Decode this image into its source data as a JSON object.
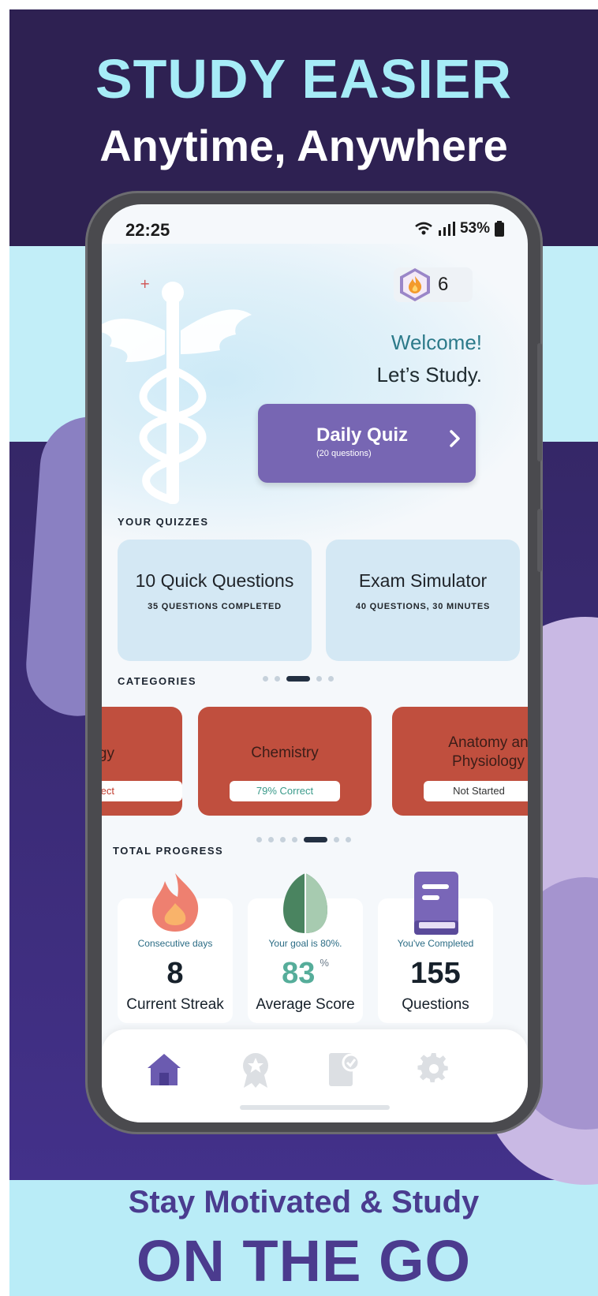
{
  "promo": {
    "headline_line1": "STUDY EASIER",
    "headline_line2": "Anytime, Anywhere",
    "footer_line1": "Stay Motivated & Study",
    "footer_line2": "ON THE GO",
    "colors": {
      "dark": "#2e2152",
      "light": "#c2eef8",
      "accent": "#a6ecf7",
      "purple_text": "#4b3b8e"
    }
  },
  "status_bar": {
    "time": "22:25",
    "battery": "53%",
    "icons": [
      "wifi-icon",
      "signal-icon",
      "battery-icon"
    ]
  },
  "header": {
    "streak_badge": {
      "icon": "flame-icon",
      "count": "6"
    },
    "welcome": "Welcome!",
    "subtitle": "Let’s Study."
  },
  "daily_quiz": {
    "title": "Daily Quiz",
    "subtitle": "(20 questions)",
    "icon": "chevron-right-icon",
    "color": "#7766b3"
  },
  "your_quizzes": {
    "label": "YOUR QUIZZES",
    "cards": [
      {
        "title": "10 Quick Questions",
        "subtitle": "35 QUESTIONS COMPLETED"
      },
      {
        "title": "Exam Simulator",
        "subtitle": "40 QUESTIONS, 30 MINUTES"
      }
    ]
  },
  "categories": {
    "label": "CATEGORIES",
    "cards": [
      {
        "title": "ogy",
        "status": "orrect",
        "status_color": "#c0392b"
      },
      {
        "title": "Chemistry",
        "status": "79% Correct",
        "status_color": "#3a9a8a"
      },
      {
        "title": "Anatomy an Physiology",
        "title_line1": "Anatomy an",
        "title_line2": "Physiology",
        "status": "Not Started",
        "status_color": "#333333"
      }
    ],
    "card_color": "#c04f3e"
  },
  "total_progress": {
    "label": "TOTAL PROGRESS",
    "stats": [
      {
        "icon": "flame-icon",
        "caption": "Consecutive days",
        "value": "8",
        "label": "Current Streak"
      },
      {
        "icon": "leaf-icon",
        "caption": "Your goal is 80%.",
        "value": "83",
        "unit": "%",
        "label": "Average Score"
      },
      {
        "icon": "book-icon",
        "caption": "You've Completed",
        "value": "155",
        "label": "Questions"
      }
    ]
  },
  "tab_bar": {
    "tabs": [
      {
        "icon": "home-icon",
        "active": true
      },
      {
        "icon": "award-icon",
        "active": false
      },
      {
        "icon": "checklist-icon",
        "active": false
      },
      {
        "icon": "gear-icon",
        "active": false
      }
    ],
    "active_color": "#6b5bb0",
    "inactive_color": "#dcdfe3"
  }
}
